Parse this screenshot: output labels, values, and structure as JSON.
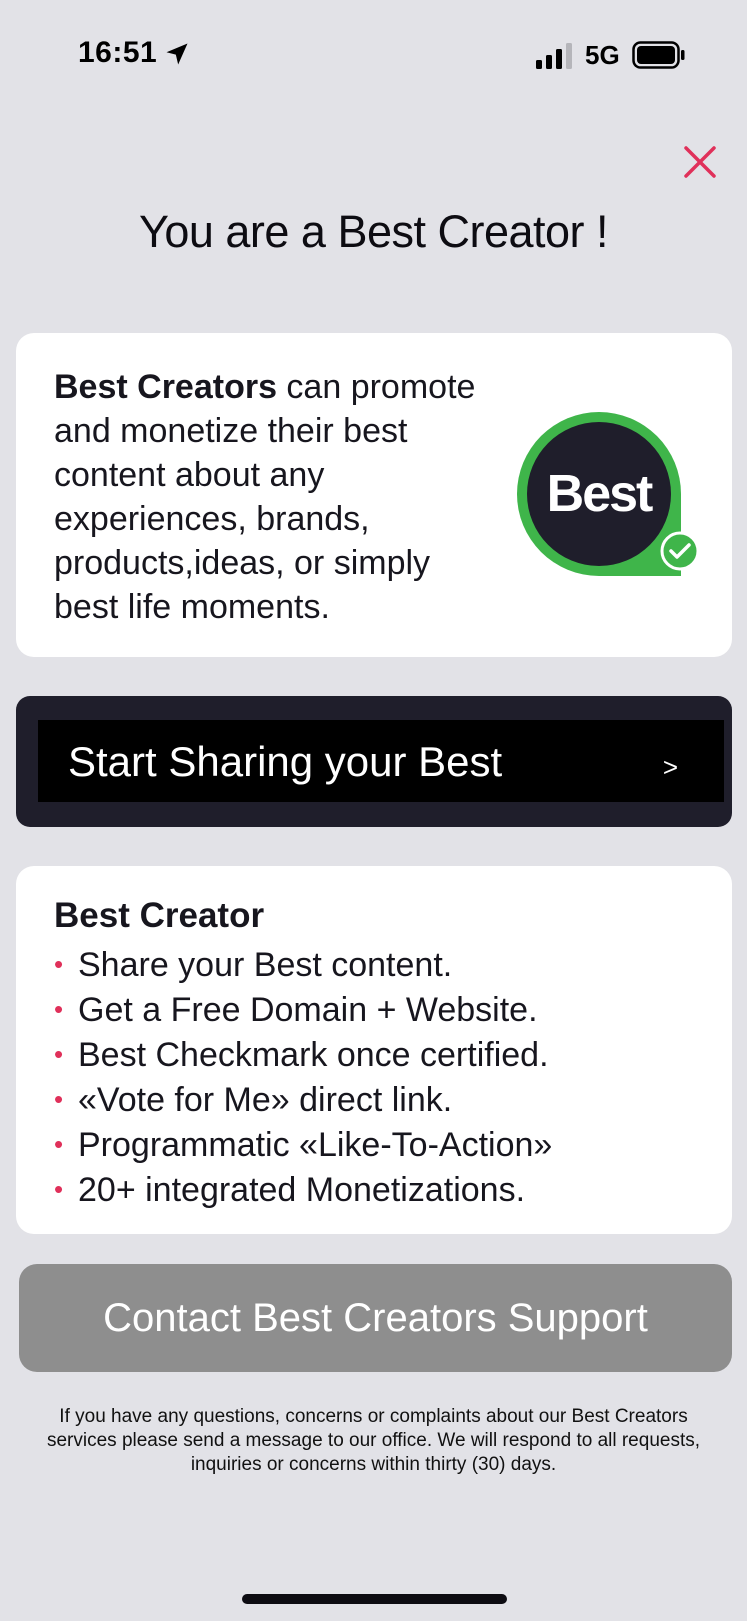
{
  "status_bar": {
    "time": "16:51",
    "network": "5G",
    "icons": [
      "location-arrow-icon",
      "signal-bars-icon",
      "battery-icon"
    ]
  },
  "header": {
    "close_icon": "close-icon",
    "title": "You are a Best Creator !"
  },
  "intro": {
    "lead_bold": "Best Creators",
    "body": " can promote and monetize their best content about any experiences, brands, products,ideas, or simply best life moments.",
    "logo_text": "Best"
  },
  "start": {
    "label": "Start Sharing your Best",
    "chevron": ">"
  },
  "features": {
    "heading": "Best Creator",
    "items": [
      "Share your Best content.",
      "Get a Free Domain + Website.",
      "Best Checkmark once certified.",
      "«Vote for Me» direct link.",
      "Programmatic «Like-To-Action»",
      "20+ integrated Monetizations."
    ]
  },
  "support": {
    "button_label": "Contact Best Creators Support",
    "note": "If you have any questions, concerns or complaints about our Best Creators services  please send a message to our office. We will respond to all requests, inquiries or concerns within thirty (30) days."
  },
  "colors": {
    "background": "#e2e2e7",
    "close_accent": "#e0305a",
    "logo_ring": "#3fb54a",
    "dark": "#1f1e2b",
    "support_button": "#8e8e8e"
  }
}
